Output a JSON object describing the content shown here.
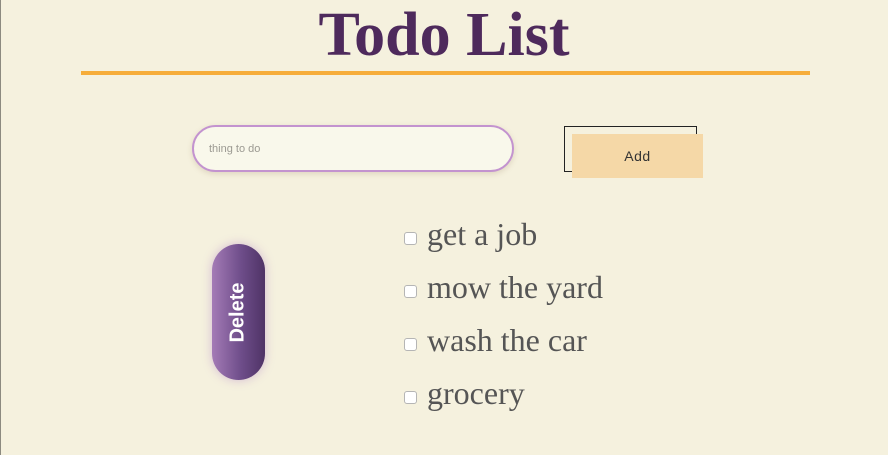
{
  "header": {
    "title": "Todo List"
  },
  "form": {
    "input_value": "",
    "input_placeholder": "thing to do",
    "add_label": "Add"
  },
  "actions": {
    "delete_label": "Delete"
  },
  "todos": [
    {
      "text": "get a job",
      "checked": false
    },
    {
      "text": "mow the yard",
      "checked": false
    },
    {
      "text": "wash the car",
      "checked": false
    },
    {
      "text": "grocery",
      "checked": false
    }
  ],
  "colors": {
    "background": "#f5f1de",
    "title": "#4e2a5c",
    "rule": "#f6ad3a",
    "input_border": "#c393cf",
    "add_button": "#f5d8a7",
    "delete_button": "#6e4d8a",
    "todo_text": "#555555"
  },
  "icons": {
    "todo_checkbox": "checkbox-icon"
  }
}
